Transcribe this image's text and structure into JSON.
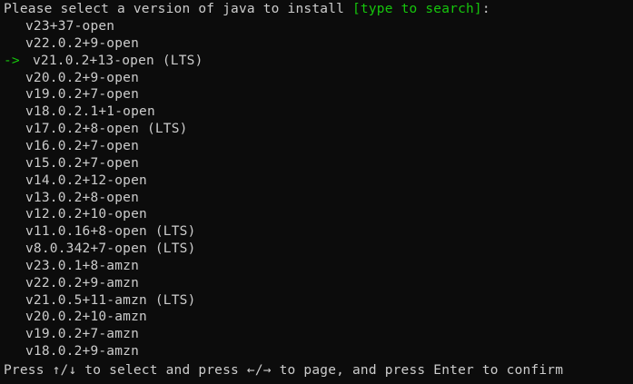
{
  "prompt": {
    "text": "Please select a version of java to install ",
    "hint": "[type to search]",
    "suffix": ":"
  },
  "cursor_arrow": "->",
  "selected_index": 2,
  "options": [
    "v23+37-open",
    "v22.0.2+9-open",
    "v21.0.2+13-open (LTS)",
    "v20.0.2+9-open",
    "v19.0.2+7-open",
    "v18.0.2.1+1-open",
    "v17.0.2+8-open (LTS)",
    "v16.0.2+7-open",
    "v15.0.2+7-open",
    "v14.0.2+12-open",
    "v13.0.2+8-open",
    "v12.0.2+10-open",
    "v11.0.16+8-open (LTS)",
    "v8.0.342+7-open (LTS)",
    "v23.0.1+8-amzn",
    "v22.0.2+9-amzn",
    "v21.0.5+11-amzn (LTS)",
    "v20.0.2+10-amzn",
    "v19.0.2+7-amzn",
    "v18.0.2+9-amzn"
  ],
  "footer": "Press ↑/↓ to select and press ←/→ to page, and press Enter to confirm",
  "colors": {
    "background": "#0c0c0c",
    "text": "#cccccc",
    "accent": "#16c60c"
  }
}
